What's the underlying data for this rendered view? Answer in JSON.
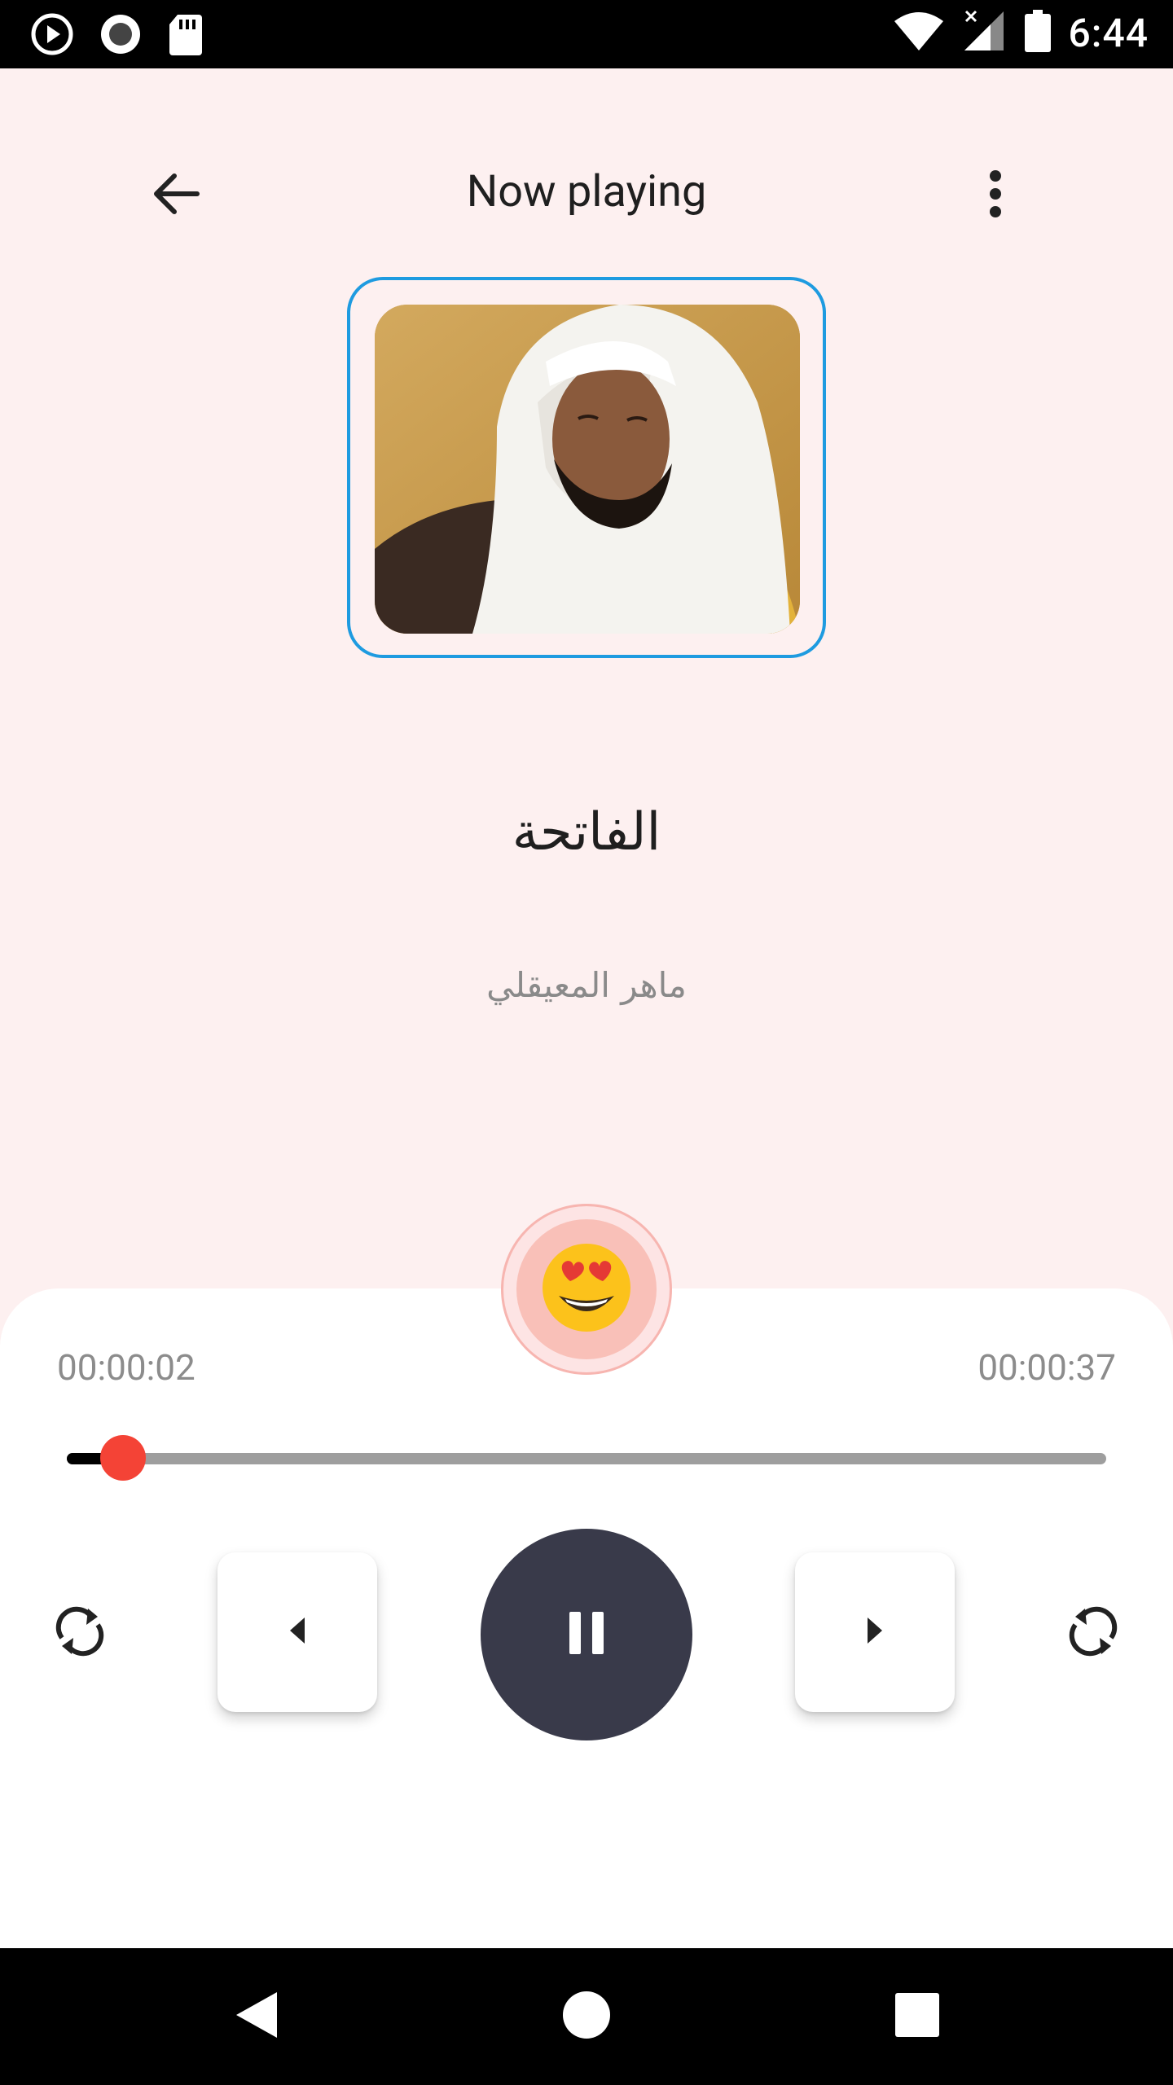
{
  "status_bar": {
    "time": "6:44",
    "icons": [
      "play-circle-icon",
      "record-icon",
      "sd-card-icon",
      "wifi-icon",
      "signal-icon",
      "battery-icon"
    ]
  },
  "header": {
    "title": "Now playing",
    "back_icon": "arrow-back-icon",
    "menu_icon": "more-vert-icon"
  },
  "track": {
    "title": "الفاتحة",
    "artist": "ماهر المعيقلي",
    "artwork_icon": "reciter-photo"
  },
  "player": {
    "favorite_icon": "heart-eyes-emoji-icon",
    "favorite_glyph": "😍",
    "elapsed": "00:00:02",
    "total": "00:00:37",
    "progress": 0.054,
    "controls": [
      "repeat-left-icon",
      "previous-icon",
      "pause-icon",
      "next-icon",
      "repeat-right-icon"
    ]
  },
  "nav_bar": {
    "icons": [
      "nav-back-icon",
      "nav-home-icon",
      "nav-recents-icon"
    ]
  },
  "colors": {
    "background": "#fdf0f0",
    "accent_border": "#1e9be0",
    "seek_thumb": "#f44336",
    "play_button": "#393a4a",
    "panel": "#ffffff"
  }
}
